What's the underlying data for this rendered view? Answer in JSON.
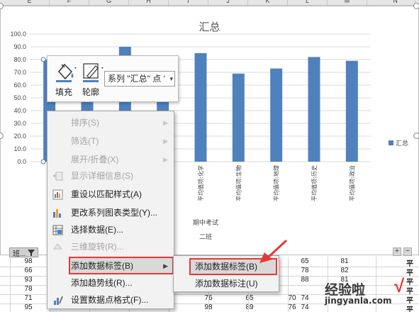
{
  "columns": [
    "E",
    "F",
    "G",
    "H",
    "I",
    "J",
    "K",
    "L",
    "M",
    "N"
  ],
  "chart_data": {
    "type": "bar",
    "title": "汇总",
    "categories": [
      "",
      "",
      "",
      "",
      "平均值项:化学",
      "平均值项:生物",
      "平均值项:地理",
      "平均值项:历史",
      "平均值项:政治"
    ],
    "values": [
      80,
      80,
      90,
      80,
      85,
      69,
      73,
      82,
      79
    ],
    "series": [
      {
        "name": "汇总",
        "values": [
          80,
          80,
          90,
          80,
          85,
          69,
          73,
          82,
          79
        ]
      }
    ],
    "y_ticks": [
      "100.0",
      "90.0",
      "80.0",
      "70.0",
      "60.0",
      "50.0",
      "40.0",
      "30.0",
      "20.0",
      "10.0",
      "0.0"
    ],
    "ylim": [
      0,
      100
    ],
    "group_labels": [
      "期中考试",
      "二班"
    ],
    "legend_position": "right",
    "grid": true,
    "bar_color": "#4f81bd"
  },
  "filter_tab": {
    "label": "班..."
  },
  "plus_label": "+",
  "minus_label": "−",
  "toolbar": {
    "fill_label": "填充",
    "outline_label": "轮廓",
    "series_select": "系列 \"汇总\" 点 '"
  },
  "context_menu": {
    "items": [
      {
        "label": "排序(S)",
        "disabled": true,
        "submenu": true
      },
      {
        "label": "筛选(T)",
        "disabled": true,
        "submenu": true
      },
      {
        "label": "展开/折叠(X)",
        "disabled": true,
        "submenu": true
      },
      {
        "label": "显示详细信息(S)",
        "disabled": true,
        "submenu": false
      },
      {
        "label": "重设以匹配样式(A)",
        "disabled": false,
        "submenu": false
      },
      {
        "label": "更改系列图表类型(Y)...",
        "disabled": false,
        "submenu": false
      },
      {
        "label": "选择数据(E)...",
        "disabled": false,
        "submenu": false
      },
      {
        "label": "三维旋转(R)...",
        "disabled": true,
        "submenu": false
      },
      {
        "label": "添加数据标签(B)",
        "disabled": false,
        "submenu": true
      },
      {
        "label": "添加趋势线(R)...",
        "disabled": false,
        "submenu": false
      },
      {
        "label": "设置数据点格式(F)...",
        "disabled": false,
        "submenu": false
      }
    ]
  },
  "submenu": {
    "items": [
      {
        "label": "添加数据标签(B)"
      },
      {
        "label": "添加数据标注(U)"
      }
    ]
  },
  "grid_rows": [
    [
      "98",
      "",
      "",
      "",
      "",
      "",
      "",
      "65",
      "81",
      "平"
    ],
    [
      "66",
      "",
      "",
      "",
      "",
      "",
      "",
      "78",
      "82",
      "平"
    ],
    [
      "93",
      "",
      "",
      "",
      "",
      "",
      "",
      "88",
      "81",
      "平"
    ],
    [
      "78",
      "",
      "",
      "",
      "",
      "",
      "",
      "",
      "",
      "平"
    ],
    [
      "71",
      "",
      "",
      "73",
      "76",
      "65",
      "70",
      "74",
      "",
      "平"
    ],
    [
      "95",
      "",
      "",
      "84",
      "98",
      "89",
      "76",
      "74",
      "",
      "平"
    ]
  ],
  "watermark": {
    "main": "经验啦",
    "sub": "jingyanla.com",
    "check": "√"
  }
}
